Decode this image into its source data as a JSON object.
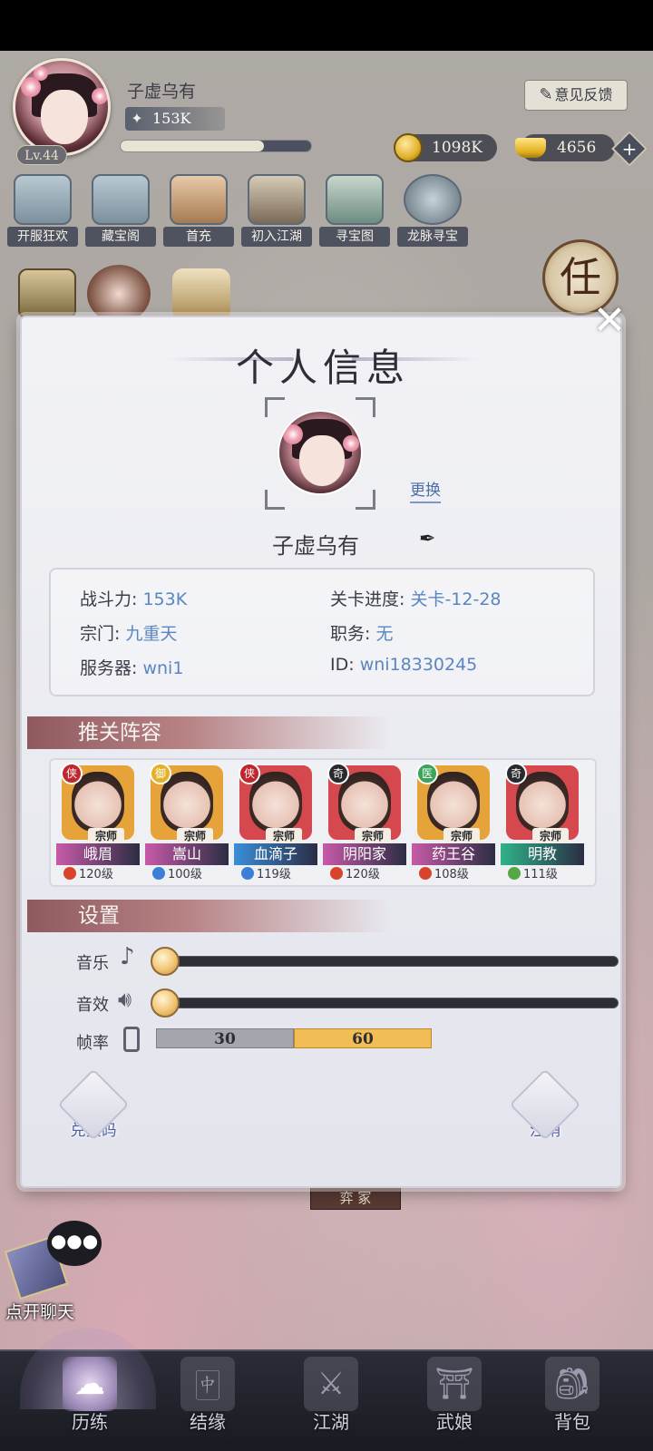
{
  "hud": {
    "player_name": "子虚乌有",
    "level_label": "Lv.44",
    "power_value": "153K",
    "exp_progress": 0.75,
    "feedback_label": "意见反馈",
    "coins": "1098K",
    "ingots": "4656",
    "plus_label": "+"
  },
  "menu": [
    {
      "label": "开服狂欢",
      "icon": "scroll-icon"
    },
    {
      "label": "藏宝阁",
      "icon": "pavilion-icon"
    },
    {
      "label": "首充",
      "icon": "gift-box-icon"
    },
    {
      "label": "初入江湖",
      "icon": "taiji-chest-icon"
    },
    {
      "label": "寻宝图",
      "icon": "treasure-map-icon"
    },
    {
      "label": "龙脉寻宝",
      "icon": "compass-icon"
    }
  ],
  "quest_button": "任",
  "modal": {
    "title": "个人信息",
    "change_label": "更换",
    "nickname": "子虚乌有",
    "info": {
      "power_label": "战斗力:",
      "power_value": "153K",
      "progress_label": "关卡进度:",
      "progress_value": "关卡-12-28",
      "sect_label": "宗门:",
      "sect_value": "九重天",
      "role_label": "职务:",
      "role_value": "无",
      "server_label": "服务器:",
      "server_value": "wni1",
      "id_label": "ID:",
      "id_value": "wni18330245"
    },
    "lineup_title": "推关阵容",
    "heroes": [
      {
        "name": "峨眉",
        "level": "120级",
        "badge": "侠",
        "plaque": "宗师",
        "frame": "#e5a33a",
        "band": "#c85aa8",
        "badge_color": "#c0262c",
        "element_color": "#d9432b"
      },
      {
        "name": "嵩山",
        "level": "100级",
        "badge": "御",
        "plaque": "宗师",
        "frame": "#e5a33a",
        "band": "#c85aa8",
        "badge_color": "#e3b128",
        "element_color": "#3c7fd6"
      },
      {
        "name": "血滴子",
        "level": "119级",
        "badge": "侠",
        "plaque": "宗师",
        "frame": "#d4484e",
        "band": "#3a8ed8",
        "badge_color": "#c0262c",
        "element_color": "#3c7fd6"
      },
      {
        "name": "阴阳家",
        "level": "120级",
        "badge": "奇",
        "plaque": "宗师",
        "frame": "#d4484e",
        "band": "#c85aa8",
        "badge_color": "#2a2a2e",
        "element_color": "#d9432b"
      },
      {
        "name": "药王谷",
        "level": "108级",
        "badge": "医",
        "plaque": "宗师",
        "frame": "#e5a33a",
        "band": "#c85aa8",
        "badge_color": "#3aa45a",
        "element_color": "#d9432b"
      },
      {
        "name": "明教",
        "level": "111级",
        "badge": "奇",
        "plaque": "宗师",
        "frame": "#d4484e",
        "band": "#2fb38a",
        "badge_color": "#2a2a2e",
        "element_color": "#55a845"
      }
    ],
    "settings_title": "设置",
    "music_label": "音乐",
    "sfx_label": "音效",
    "fps_label": "帧率",
    "music_level": 0,
    "sfx_level": 0,
    "fps_options": [
      "30",
      "60"
    ],
    "fps_selected": "60",
    "redeem_label": "兑换码",
    "logout_label": "注销"
  },
  "stage_sign": "弈 冢",
  "chat": {
    "label": "点开聊天",
    "bubble": "●●●"
  },
  "bottom_nav": [
    {
      "label": "历练",
      "active": true,
      "icon": "cloud-icon"
    },
    {
      "label": "结缘",
      "active": false,
      "icon": "mahjong-tile-icon"
    },
    {
      "label": "江湖",
      "active": false,
      "icon": "crossed-swords-icon"
    },
    {
      "label": "武娘",
      "active": false,
      "icon": "bamboo-hat-icon"
    },
    {
      "label": "背包",
      "active": false,
      "icon": "backpack-icon"
    }
  ]
}
